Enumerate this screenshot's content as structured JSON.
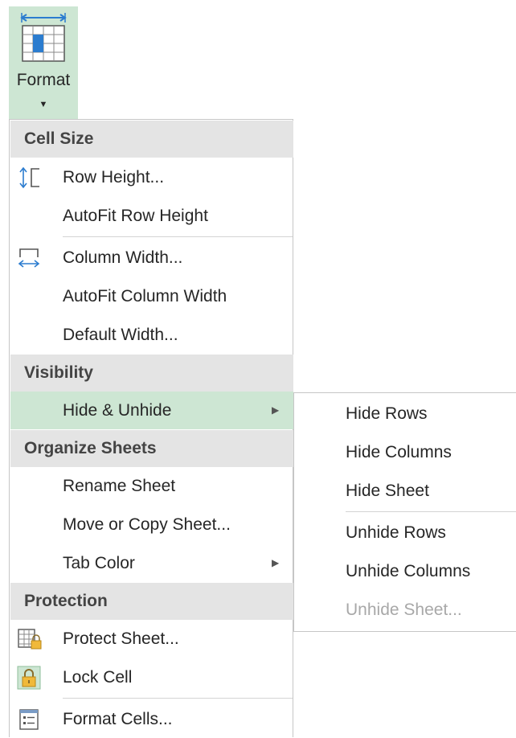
{
  "ribbon": {
    "format_label": "Format",
    "format_icon": "format-cells-icon",
    "accent_color": "#cde6d3"
  },
  "menu": {
    "cell_size": {
      "header": "Cell Size",
      "row_height": "Row Height...",
      "autofit_row_height": "AutoFit Row Height",
      "column_width": "Column Width...",
      "autofit_column_width": "AutoFit Column Width",
      "default_width": "Default Width..."
    },
    "visibility": {
      "header": "Visibility",
      "hide_unhide": "Hide & Unhide"
    },
    "organize": {
      "header": "Organize Sheets",
      "rename_sheet": "Rename Sheet",
      "move_copy": "Move or Copy Sheet...",
      "tab_color": "Tab Color"
    },
    "protection": {
      "header": "Protection",
      "protect_sheet": "Protect Sheet...",
      "lock_cell": "Lock Cell",
      "format_cells": "Format Cells..."
    }
  },
  "submenu": {
    "hide_rows": "Hide Rows",
    "hide_columns": "Hide Columns",
    "hide_sheet": "Hide Sheet",
    "unhide_rows": "Unhide Rows",
    "unhide_columns": "Unhide Columns",
    "unhide_sheet": "Unhide Sheet..."
  }
}
